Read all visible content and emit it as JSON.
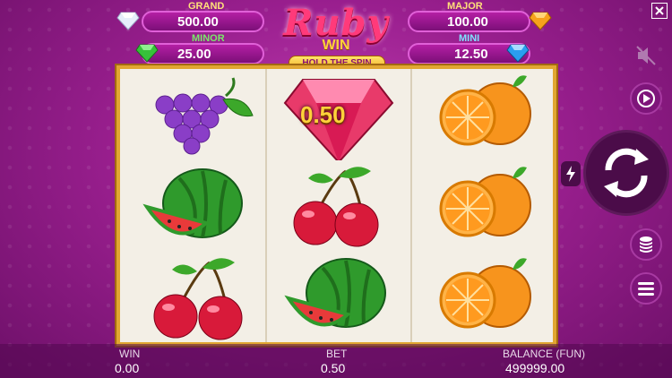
{
  "jackpots": {
    "grand": {
      "label": "GRAND",
      "value": "500.00",
      "label_color": "#ffe07a"
    },
    "minor": {
      "label": "MINOR",
      "value": "25.00",
      "label_color": "#7ae96b"
    },
    "major": {
      "label": "MAJOR",
      "value": "100.00",
      "label_color": "#ffe07a"
    },
    "mini": {
      "label": "MINI",
      "value": "12.50",
      "label_color": "#7fe3ff"
    }
  },
  "logo": {
    "title": "Ruby",
    "subtitle": "WIN",
    "tagline": "HOLD THE SPIN"
  },
  "reels": [
    [
      "grape-icon",
      "watermelon-icon",
      "cherry-icon"
    ],
    [
      "ruby-icon",
      "cherry-icon",
      "watermelon-icon"
    ],
    [
      "orange-icon",
      "orange-icon",
      "orange-icon"
    ]
  ],
  "ruby_value": "0.50",
  "controls": [
    "mute-icon",
    "autoplay-icon",
    "turbo-icon",
    "spin-icon",
    "bet-coins-icon",
    "menu-icon",
    "close-icon"
  ],
  "bottom_bar": {
    "win_label": "WIN",
    "win_value": "0.00",
    "bet_label": "BET",
    "bet_value": "0.50",
    "balance_label": "BALANCE (FUN)",
    "balance_value": "499999.00"
  },
  "colors": {
    "frame": "#e1a631",
    "background": "#9a1f8f",
    "accent": "#ffd23a"
  }
}
